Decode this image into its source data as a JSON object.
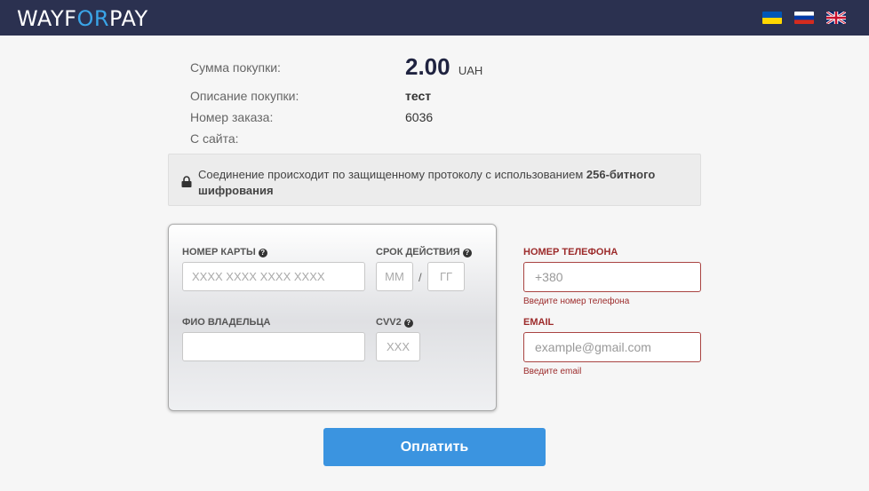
{
  "header": {
    "logo": {
      "part1": "WAYF",
      "accent": "OR",
      "part2": "PAY"
    },
    "languages": [
      {
        "code": "ua",
        "icon": "ukraine-flag-icon",
        "colors": [
          "#0057b7",
          "#ffd700"
        ]
      },
      {
        "code": "ru",
        "icon": "russia-flag-icon",
        "colors": [
          "#ffffff",
          "#0039a6",
          "#d52b1e"
        ]
      },
      {
        "code": "en",
        "icon": "uk-flag-icon",
        "colors": [
          "#012169",
          "#ffffff",
          "#c8102e"
        ]
      }
    ]
  },
  "summary": {
    "amount_label": "Сумма покупки:",
    "amount_value": "2.00",
    "currency": "UAH",
    "description_label": "Описание покупки:",
    "description_value": "тест",
    "order_label": "Номер заказа:",
    "order_value": "6036",
    "site_label": "С сайта:",
    "site_value": ""
  },
  "security": {
    "icon": "lock-icon",
    "text": "Соединение происходит по защищенному протоколу с использованием ",
    "text_bold": "256-битного шифрования"
  },
  "card_form": {
    "card_number_label": "НОМЕР КАРТЫ",
    "card_number_placeholder": "XXXX XXXX XXXX XXXX",
    "card_number_value": "",
    "expiry_label": "СРОК ДЕЙСТВИЯ",
    "month_placeholder": "ММ",
    "year_placeholder": "ГГ",
    "expiry_separator": "/",
    "holder_label": "ФИО ВЛАДЕЛЬЦА",
    "holder_value": "",
    "cvv_label": "CVV2",
    "cvv_placeholder": "XXX",
    "help_icon": "question-circle-icon",
    "help_glyph": "?"
  },
  "contact": {
    "phone_label": "НОМЕР ТЕЛЕФОНА",
    "phone_placeholder": "+380",
    "phone_error": "Введите номер телефона",
    "email_label": "EMAIL",
    "email_placeholder": "example@gmail.com",
    "email_error": "Введите email",
    "error_color": "#a94442"
  },
  "actions": {
    "pay_label": "Оплатить",
    "pay_color": "#3b94e0"
  }
}
